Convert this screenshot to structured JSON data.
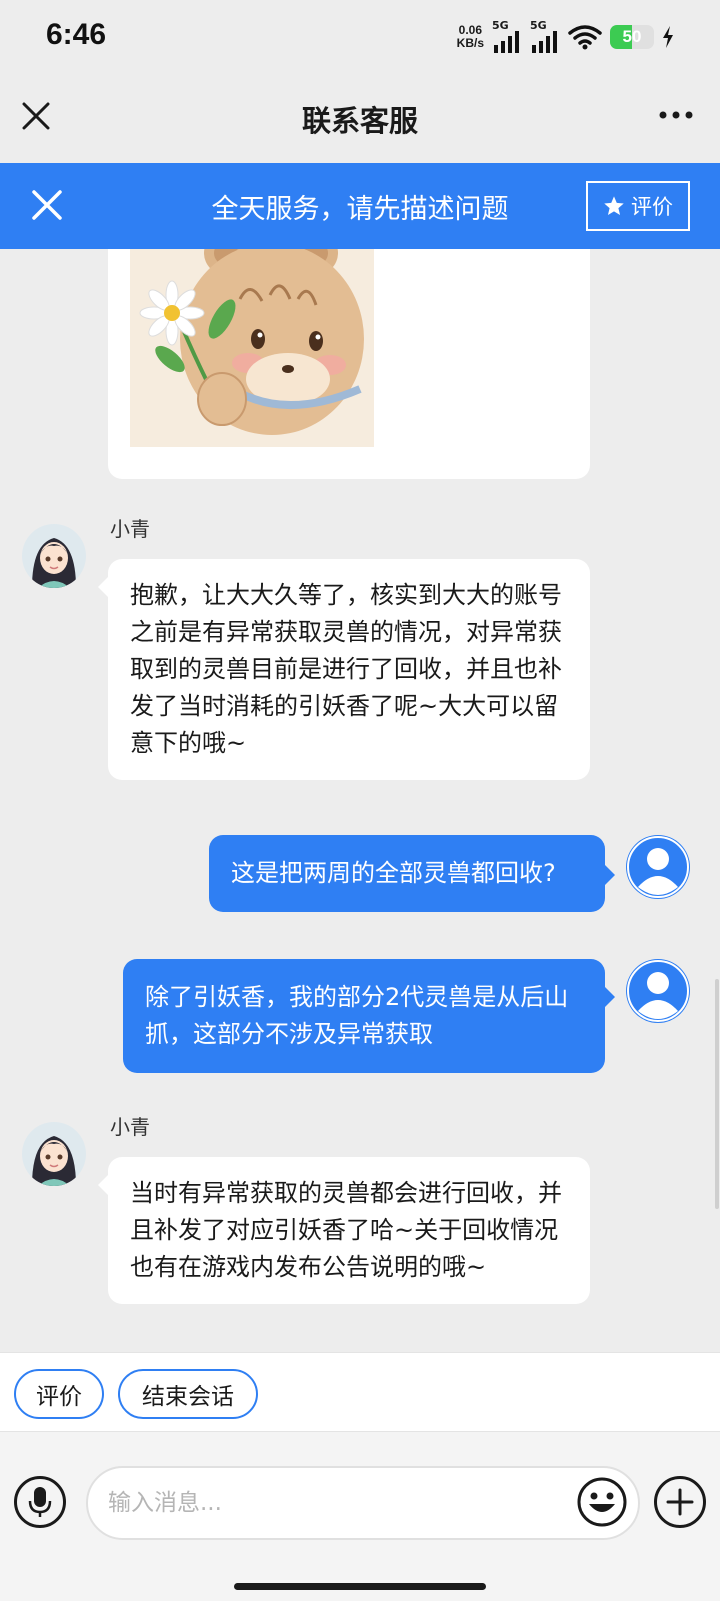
{
  "status_bar": {
    "time": "6:46",
    "net_speed_value": "0.06",
    "net_speed_unit": "KB/s",
    "sim1_label": "5G",
    "sim2_label": "5G",
    "battery_level": "50",
    "battery_fraction": 0.5,
    "battery_color": "#3ccb52"
  },
  "title_bar": {
    "title": "联系客服",
    "close_icon": "close-icon",
    "more_icon": "more-dots-icon"
  },
  "banner": {
    "text": "全天服务，请先描述问题",
    "rate_label": "评价",
    "color": "#2f7ff3"
  },
  "messages": [
    {
      "sender": "agent",
      "type": "image",
      "image": "bear-holding-daisy-sticker"
    },
    {
      "sender": "agent",
      "name": "小青",
      "text": "抱歉，让大大久等了，核实到大大的账号之前是有异常获取灵兽的情况，对异常获取到的灵兽目前是进行了回收，并且也补发了当时消耗的引妖香了呢~大大可以留意下的哦~"
    },
    {
      "sender": "user",
      "text": "这是把两周的全部灵兽都回收?"
    },
    {
      "sender": "user",
      "text": "除了引妖香，我的部分2代灵兽是从后山抓，这部分不涉及异常获取"
    },
    {
      "sender": "agent",
      "name": "小青",
      "text": "当时有异常获取的灵兽都会进行回收，并且补发了对应引妖香了哈~关于回收情况也有在游戏内发布公告说明的哦~"
    }
  ],
  "quick_actions": {
    "rate": "评价",
    "end_session": "结束会话"
  },
  "input_bar": {
    "placeholder": "输入消息...",
    "mic_icon": "microphone-icon",
    "emoji_icon": "emoji-icon",
    "plus_icon": "plus-icon"
  },
  "colors": {
    "accent": "#2f7ff3",
    "background": "#ededed"
  }
}
